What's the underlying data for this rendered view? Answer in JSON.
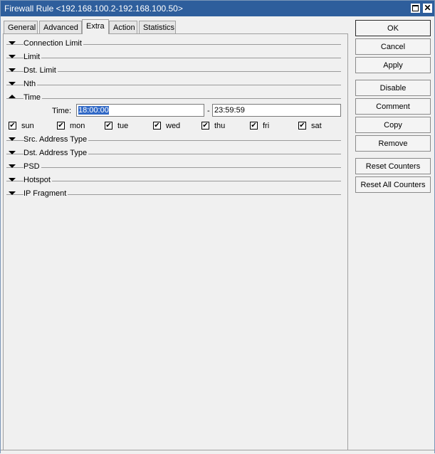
{
  "window": {
    "title": "Firewall Rule <192.168.100.2-192.168.100.50>"
  },
  "tabs": [
    {
      "label": "General"
    },
    {
      "label": "Advanced"
    },
    {
      "label": "Extra"
    },
    {
      "label": "Action"
    },
    {
      "label": "Statistics"
    }
  ],
  "sections": {
    "connection_limit": "Connection Limit",
    "limit": "Limit",
    "dst_limit": "Dst. Limit",
    "nth": "Nth",
    "time": "Time",
    "src_address_type": "Src. Address Type",
    "dst_address_type": "Dst. Address Type",
    "psd": "PSD",
    "hotspot": "Hotspot",
    "ip_fragment": "IP Fragment"
  },
  "time": {
    "label": "Time:",
    "from": "18:00:00",
    "separator": "-",
    "to": "23:59:59",
    "days": [
      {
        "label": "sun",
        "checked": true
      },
      {
        "label": "mon",
        "checked": true
      },
      {
        "label": "tue",
        "checked": true
      },
      {
        "label": "wed",
        "checked": true
      },
      {
        "label": "thu",
        "checked": true
      },
      {
        "label": "fri",
        "checked": true
      },
      {
        "label": "sat",
        "checked": true
      }
    ]
  },
  "buttons": {
    "ok": "OK",
    "cancel": "Cancel",
    "apply": "Apply",
    "disable": "Disable",
    "comment": "Comment",
    "copy": "Copy",
    "remove": "Remove",
    "reset_counters": "Reset Counters",
    "reset_all_counters": "Reset All Counters"
  },
  "colors": {
    "titlebar": "#2e5e9c",
    "selection": "#3169c6"
  }
}
